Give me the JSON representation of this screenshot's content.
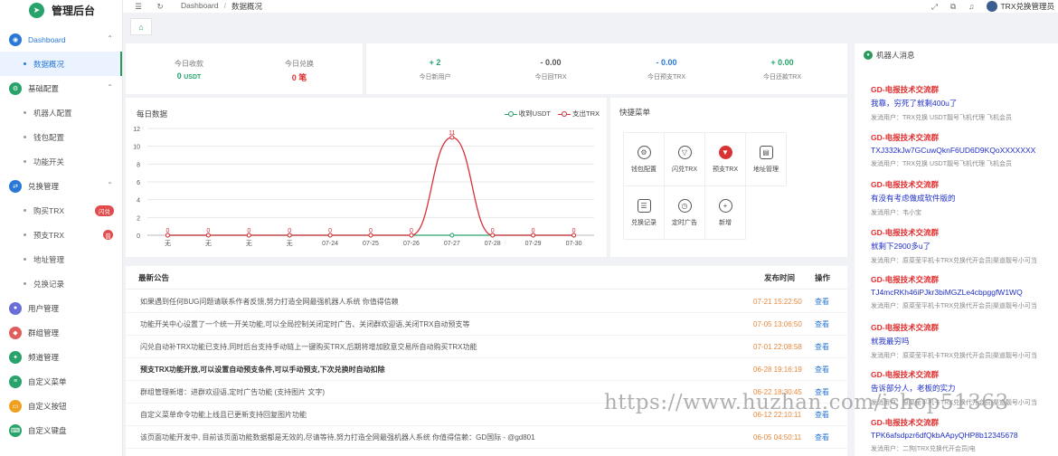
{
  "brand": {
    "title": "管理后台"
  },
  "sidebar": {
    "items": [
      {
        "label": "Dashboard",
        "icon": "dashboard-icon",
        "color": "#2a78d6",
        "expanded": true,
        "children": [
          {
            "label": "数据概况",
            "active": true
          }
        ]
      },
      {
        "label": "基础配置",
        "icon": "settings-icon",
        "color": "#27a36b",
        "expanded": true,
        "children": [
          {
            "label": "机器人配置"
          },
          {
            "label": "钱包配置"
          },
          {
            "label": "功能开关"
          }
        ]
      },
      {
        "label": "兑换管理",
        "icon": "exchange-icon",
        "color": "#2a78d6",
        "expanded": true,
        "children": [
          {
            "label": "购买TRX",
            "badge": "闪兑"
          },
          {
            "label": "预支TRX",
            "badge": "普"
          },
          {
            "label": "地址管理"
          },
          {
            "label": "兑换记录"
          }
        ]
      },
      {
        "label": "用户管理",
        "icon": "user-icon",
        "color": "#6a6fd8"
      },
      {
        "label": "群组管理",
        "icon": "group-icon",
        "color": "#e05d5d"
      },
      {
        "label": "频道管理",
        "icon": "channel-icon",
        "color": "#27a36b"
      },
      {
        "label": "自定义菜单",
        "icon": "menu-icon",
        "color": "#27a36b"
      },
      {
        "label": "自定义按钮",
        "icon": "button-icon",
        "color": "#f0a020"
      },
      {
        "label": "自定义键盘",
        "icon": "keyboard-icon",
        "color": "#27a36b"
      }
    ]
  },
  "header": {
    "breadcrumb": [
      "Dashboard",
      "/",
      "数据概况"
    ],
    "user": "TRX兑换管理员"
  },
  "stats_left": [
    {
      "label": "今日收款",
      "value": "0",
      "unit": "USDT",
      "color": "#27a36b"
    },
    {
      "label": "今日兑换",
      "value": "0",
      "unit": "笔",
      "color": "#e02e2e"
    }
  ],
  "stats_right": [
    {
      "label": "今日新用户",
      "value": "+ 2",
      "color": "#27a36b"
    },
    {
      "label": "今日回TRX",
      "value": "- 0.00",
      "color": "#555555"
    },
    {
      "label": "今日预支TRX",
      "value": "- 0.00",
      "color": "#2a78d6"
    },
    {
      "label": "今日还款TRX",
      "value": "+ 0.00",
      "color": "#27a36b"
    }
  ],
  "chart_data": {
    "type": "line",
    "title": "每日数据",
    "categories": [
      "无",
      "无",
      "无",
      "无",
      "07-24",
      "07-25",
      "07-26",
      "07-27",
      "07-28",
      "07-29",
      "07-30"
    ],
    "series": [
      {
        "name": "收到USDT",
        "color": "#27a36b",
        "values": [
          0,
          0,
          0,
          0,
          0,
          0,
          0,
          0,
          0,
          0,
          0
        ]
      },
      {
        "name": "支出TRX",
        "color": "#d9303a",
        "values": [
          0,
          0,
          0,
          0,
          0,
          0,
          0,
          11,
          0,
          0,
          0
        ]
      }
    ],
    "point_labels": [
      "0",
      "0",
      "0",
      "0",
      "0",
      "0",
      "0",
      "11",
      "0",
      "0",
      "0"
    ],
    "ylim": [
      0,
      12
    ],
    "yticks": [
      0,
      2,
      4,
      6,
      8,
      10,
      12
    ],
    "grid": true,
    "legend": "top-right"
  },
  "quick_menu": {
    "title": "快捷菜单",
    "items": [
      {
        "label": "钱包配置",
        "icon": "hexagon-icon",
        "glyph": "⚙"
      },
      {
        "label": "闪兑TRX",
        "icon": "tron-icon",
        "glyph": "▽"
      },
      {
        "label": "预支TRX",
        "icon": "tron-red-icon",
        "glyph": "▼",
        "red": true
      },
      {
        "label": "地址管理",
        "icon": "wallet-icon",
        "glyph": "▤",
        "square": true
      },
      {
        "label": "兑换记录",
        "icon": "record-icon",
        "glyph": "☰",
        "square": true
      },
      {
        "label": "定时广告",
        "icon": "clock-icon",
        "glyph": "◷"
      },
      {
        "label": "新增",
        "icon": "plus-icon",
        "glyph": "+"
      }
    ]
  },
  "announcements": {
    "title": "最新公告",
    "col_time": "发布时间",
    "col_action": "操作",
    "rows": [
      {
        "text": "如果遇到任何BUG问题请联系作者反馈,努力打造全网最强机器人系统 你值得信赖",
        "date": "07-21 15:22:50",
        "action": "查看"
      },
      {
        "text": "功能开关中心设置了一个统一开关功能,可以全局控制关闭定时广告、关闭群欢迎语,关闭TRX自动预支等",
        "date": "07-05 13:06:50",
        "action": "查看"
      },
      {
        "text": "闪兑自动补TRX功能已支持,同时后台支持手动链上一键购买TRX,后期将增加欧意交易所自动购买TRX功能",
        "date": "07-01 22:08:58",
        "action": "查看"
      },
      {
        "text": "预支TRX功能开放,可以设置自动预支条件,可以手动预支,下次兑换时自动扣除",
        "date": "06-28 19:16:19",
        "action": "查看",
        "bold": true
      },
      {
        "text": "群组管理新增：进群欢迎语,定时广告功能 (支持图片 文字)",
        "date": "06-22 18:30:45",
        "action": "查看"
      },
      {
        "text": "自定义菜单命令功能上线且已更新支持回复图片功能",
        "date": "06-12 22:10:11",
        "action": "查看"
      },
      {
        "text": "该页面功能开发中, 目前该页面功能数据都是无效的,尽请等待,努力打造全网最强机器人系统 你值得信赖：GD国际 - @gd801",
        "date": "06-05 04:50:11",
        "action": "查看"
      }
    ]
  },
  "robot_messages": {
    "title": "机器人消息",
    "items": [
      {
        "group": "GD-电报技术交流群",
        "message": "我靠，穷死了就剩400u了",
        "from": "发消用户：TRX兑换 USDT靓号飞机代理 飞机会员"
      },
      {
        "group": "GD-电报技术交流群",
        "message": "TXJ332kJw7GCuwQknF6UD6D9KQoXXXXXXX",
        "from": "发消用户：TRX兑换 USDT靓号飞机代理 飞机会员"
      },
      {
        "group": "GD-电报技术交流群",
        "message": "有没有考虑做成软件版的",
        "from": "发消用户：韦小宝"
      },
      {
        "group": "GD-电报技术交流群",
        "message": "就剩下2900多u了",
        "from": "发消用户：原菜莹平机卡TRX兑换代开会员|渠道靓号小可当"
      },
      {
        "group": "GD-电报技术交流群",
        "message": "TJ4mcRKh46iPJkr3biMGZLe4cbpggfW1WQ",
        "from": "发消用户：原菜莹平机卡TRX兑换代开会员|渠道靓号小可当"
      },
      {
        "group": "GD-电报技术交流群",
        "message": "就我最穷吗",
        "from": "发消用户：原菜莹平机卡TRX兑换代开会员|渠道靓号小可当"
      },
      {
        "group": "GD-电报技术交流群",
        "message": "告诉部分人，老板的实力",
        "from": "发消用户：原菜莹平机卡TRX兑换代开会员|渠道靓号小可当"
      },
      {
        "group": "GD-电报技术交流群",
        "message": "TPK6afsdpzr6dfQkbAApyQHP8b12345678",
        "from": "发消用户：二狗|TRX兑换代开会员|电"
      }
    ]
  },
  "watermark": "https://www.huzhan.com/ishop51363"
}
